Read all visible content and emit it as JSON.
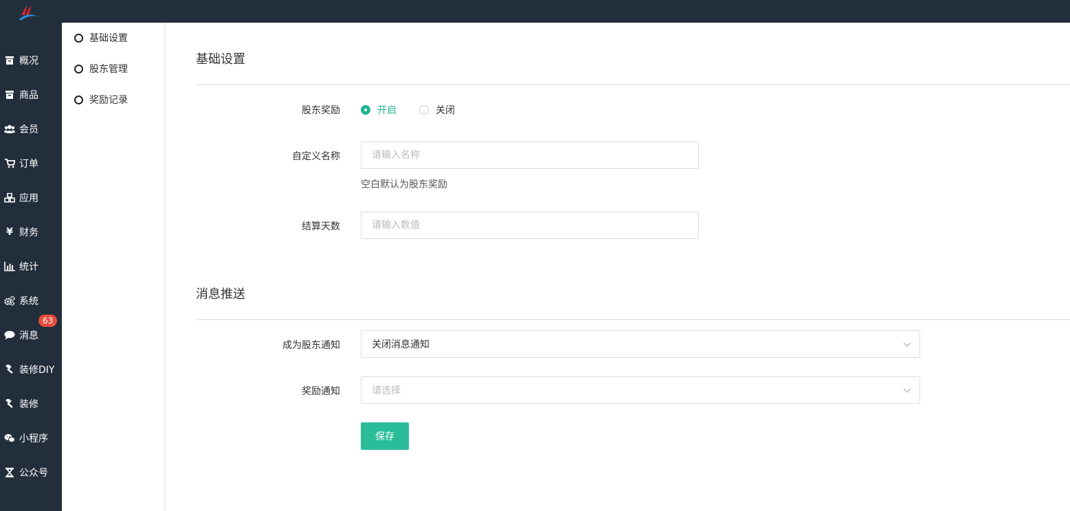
{
  "brand": {
    "logo_icon": "brand-logo",
    "colors": {
      "sidebar": "#232e3c",
      "accent": "#2bbd9a",
      "badge": "#e74c3c"
    }
  },
  "sidebar": {
    "items": [
      {
        "label": "概况",
        "icon": "box-icon"
      },
      {
        "label": "商品",
        "icon": "box-icon"
      },
      {
        "label": "会员",
        "icon": "users-icon"
      },
      {
        "label": "订单",
        "icon": "cart-icon"
      },
      {
        "label": "应用",
        "icon": "cubes-icon"
      },
      {
        "label": "财务",
        "icon": "yen-icon"
      },
      {
        "label": "统计",
        "icon": "bar-chart-icon"
      },
      {
        "label": "系统",
        "icon": "gears-icon"
      },
      {
        "label": "消息",
        "icon": "comment-icon",
        "badge": "63"
      },
      {
        "label": "装修DIY",
        "icon": "gavel-icon"
      },
      {
        "label": "装修",
        "icon": "gavel-icon"
      },
      {
        "label": "小程序",
        "icon": "wechat-icon"
      },
      {
        "label": "公众号",
        "icon": "hourglass-icon"
      }
    ]
  },
  "subnav": {
    "items": [
      {
        "label": "基础设置"
      },
      {
        "label": "股东管理"
      },
      {
        "label": "奖励记录"
      }
    ]
  },
  "form": {
    "section1_title": "基础设置",
    "reward_label": "股东奖励",
    "reward_on": "开启",
    "reward_off": "关闭",
    "reward_selected": "开启",
    "name_label": "自定义名称",
    "name_placeholder": "请输入名称",
    "name_value": "",
    "name_hint": "空白默认为股东奖励",
    "days_label": "结算天数",
    "days_placeholder": "请输入数值",
    "days_value": "",
    "section2_title": "消息推送",
    "notify_label": "成为股东通知",
    "notify_value": "关闭消息通知",
    "reward_notify_label": "奖励通知",
    "reward_notify_value": "请选择",
    "save_label": "保存"
  }
}
